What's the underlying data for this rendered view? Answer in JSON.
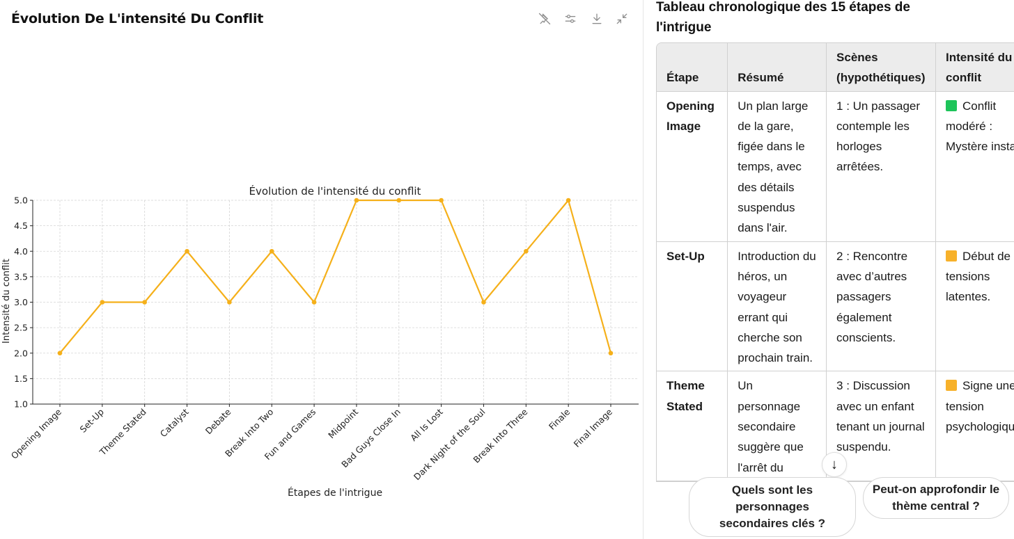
{
  "panel": {
    "title": "Évolution De L'intensité Du Conflit",
    "tool_icons": [
      "pin-off-icon",
      "sliders-icon",
      "download-icon",
      "collapse-icon"
    ]
  },
  "chart_data": {
    "type": "line",
    "title": "Évolution de l'intensité du conflit",
    "xlabel": "Étapes de l'intrigue",
    "ylabel": "Intensité du conflit",
    "categories": [
      "Opening Image",
      "Set-Up",
      "Theme Stated",
      "Catalyst",
      "Debate",
      "Break Into Two",
      "Fun and Games",
      "Midpoint",
      "Bad Guys Close In",
      "All Is Lost",
      "Dark Night of the Soul",
      "Break Into Three",
      "Finale",
      "Final Image"
    ],
    "values": [
      2,
      3,
      3,
      4,
      3,
      4,
      3,
      5,
      5,
      5,
      3,
      4,
      5,
      2
    ],
    "ylim": [
      1.0,
      5.0
    ],
    "yticks": [
      "1.0",
      "1.5",
      "2.0",
      "2.5",
      "3.0",
      "3.5",
      "4.0",
      "4.5",
      "5.0"
    ],
    "grid": true,
    "color": "#f5b01a"
  },
  "table": {
    "heading": "Tableau chronologique des 15 étapes de l'intrigue",
    "headers": [
      "Étape",
      "Résumé",
      "Scènes (hypothétiques)",
      "Intensité du conflit"
    ],
    "rows": [
      {
        "step": "Opening Image",
        "summary": "Un plan large de la gare, figée dans le temps, avec des détails suspendus dans l'air.",
        "scene": "1 : Un passager contemple les horloges arrêtées.",
        "intensity": "Conflit modéré : Mystère instal",
        "color": "#1ec45a"
      },
      {
        "step": "Set-Up",
        "summary": "Introduction du héros, un voyageur errant qui cherche son prochain train.",
        "scene": "2 : Rencontre avec d’autres passagers également conscients.",
        "intensity": "Début de tensions latentes.",
        "color": "#f7b12a"
      },
      {
        "step": "Theme Stated",
        "summary": "Un personnage secondaire suggère que l'arrêt du",
        "scene": "3 : Discussion avec un enfant tenant un journal suspendu.",
        "intensity": "Signe une tension psychologique",
        "color": "#f7b12a"
      }
    ]
  },
  "scroll_down_icon": "arrow-down-icon",
  "suggestions": [
    "Quels sont les personnages secondaires clés ?",
    "Peut-on approfondir le thème central ?"
  ]
}
